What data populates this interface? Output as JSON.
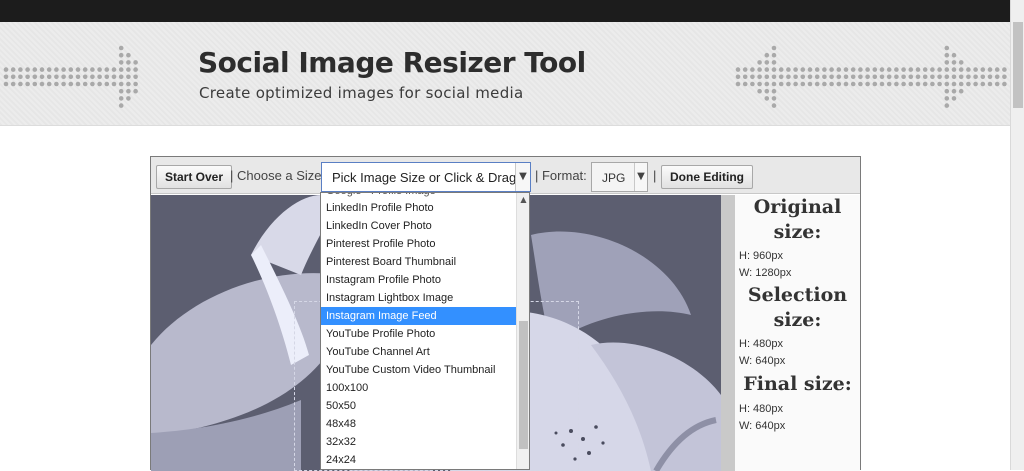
{
  "banner": {
    "title": "Social Image Resizer Tool",
    "subtitle": "Create optimized images for social media"
  },
  "toolbar": {
    "start_over_label": "Start Over",
    "choose_size_label": "| Choose a Size:",
    "size_select_value": "Pick Image Size or Click & Drag",
    "format_label": "| Format:",
    "format_value": "JPG",
    "separator": "|",
    "done_editing_label": "Done Editing"
  },
  "size_options": {
    "partial_top": "Google+ Profile Image",
    "items": [
      "LinkedIn Profile Photo",
      "LinkedIn Cover Photo",
      "Pinterest Profile Photo",
      "Pinterest Board Thumbnail",
      "Instagram Profile Photo",
      "Instagram Lightbox Image",
      "Instagram Image Feed",
      "YouTube Profile Photo",
      "YouTube Channel Art",
      "YouTube Custom Video Thumbnail",
      "100x100",
      "50x50",
      "48x48",
      "32x32",
      "24x24"
    ],
    "selected": "Instagram Image Feed",
    "selected_color": "#3390ff"
  },
  "info": {
    "original_heading_1": "Original",
    "original_heading_2": "size:",
    "original_h": "H: 960px",
    "original_w": "W: 1280px",
    "selection_heading_1": "Selection",
    "selection_heading_2": "size:",
    "selection_h": "H: 480px",
    "selection_w": "W: 640px",
    "final_heading": "Final size:",
    "final_h": "H: 480px",
    "final_w": "W: 640px"
  },
  "icons": {
    "select_arrow": "chevron-down-icon",
    "scroll_up": "caret-up-icon"
  }
}
